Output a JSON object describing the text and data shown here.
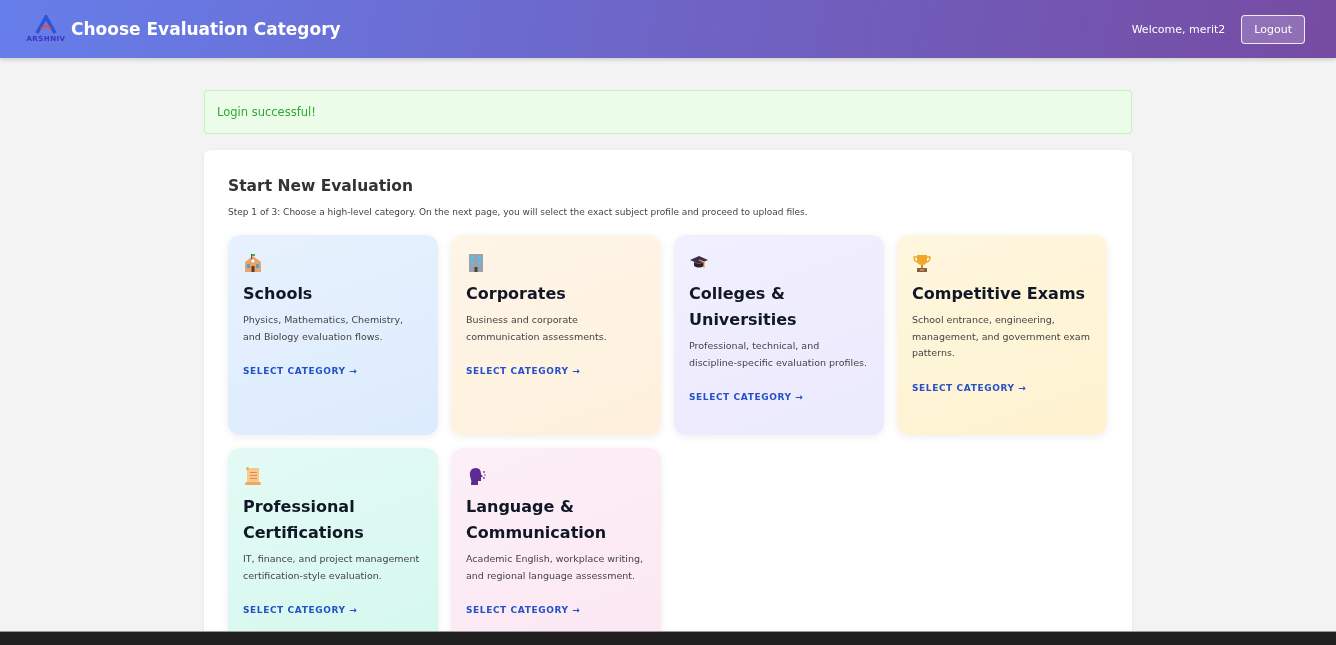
{
  "header": {
    "logo_text": "ARSHNIV",
    "title": "Choose Evaluation Category",
    "welcome": "Welcome, merit2",
    "logout": "Logout"
  },
  "alert": {
    "message": "Login successful!"
  },
  "panel": {
    "title": "Start New Evaluation",
    "subtitle": "Step 1 of 3: Choose a high-level category. On the next page, you will select the exact subject profile and proceed to upload files.",
    "categories": [
      {
        "title": "Schools",
        "description": "Physics, Mathematics, Chemistry, and Biology evaluation flows.",
        "link": "SELECT CATEGORY →",
        "color": "#dcebfd"
      },
      {
        "title": "Corporates",
        "description": "Business and corporate communication assessments.",
        "link": "SELECT CATEGORY →",
        "color": "#fef0dc"
      },
      {
        "title": "Colleges & Universities",
        "description": "Professional, technical, and discipline-specific evaluation profiles.",
        "link": "SELECT CATEGORY →",
        "color": "#ebe9fd"
      },
      {
        "title": "Competitive Exams",
        "description": "School entrance, engineering, management, and government exam patterns.",
        "link": "SELECT CATEGORY →",
        "color": "#fef2cf"
      },
      {
        "title": "Professional Certifications",
        "description": "IT, finance, and project management certification-style evaluation.",
        "link": "SELECT CATEGORY →",
        "color": "#d5f8ee"
      },
      {
        "title": "Language & Communication",
        "description": "Academic English, workplace writing, and regional language assessment.",
        "link": "SELECT CATEGORY →",
        "color": "#fbe7f2"
      }
    ]
  }
}
